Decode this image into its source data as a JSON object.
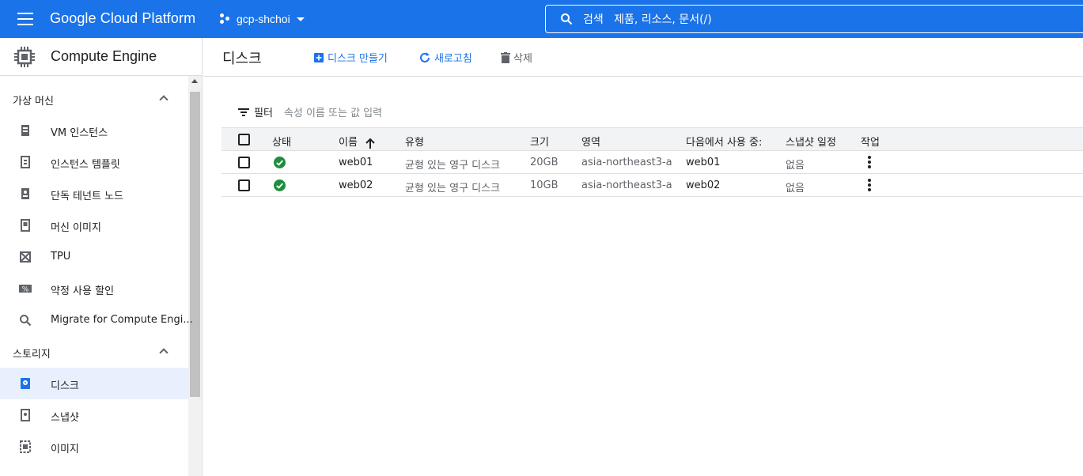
{
  "topbar": {
    "brand": "Google Cloud Platform",
    "project": "gcp-shchoi",
    "search_placeholder": "검색   제품, 리소스, 문서(/)"
  },
  "sidebar": {
    "product": "Compute Engine",
    "sections": [
      {
        "label": "가상 머신",
        "items": [
          {
            "label": "VM 인스턴스",
            "icon": "vm-icon"
          },
          {
            "label": "인스턴스 템플릿",
            "icon": "template-icon"
          },
          {
            "label": "단독 테넌트 노드",
            "icon": "node-icon"
          },
          {
            "label": "머신 이미지",
            "icon": "machine-image-icon"
          },
          {
            "label": "TPU",
            "icon": "tpu-icon"
          },
          {
            "label": "약정 사용 할인",
            "icon": "percent-icon"
          },
          {
            "label": "Migrate for Compute Engi...",
            "icon": "search-icon"
          }
        ]
      },
      {
        "label": "스토리지",
        "items": [
          {
            "label": "디스크",
            "icon": "disk-icon",
            "active": true
          },
          {
            "label": "스냅샷",
            "icon": "snapshot-icon"
          },
          {
            "label": "이미지",
            "icon": "image-icon"
          }
        ]
      }
    ]
  },
  "toolbar": {
    "title": "디스크",
    "create_label": "디스크 만들기",
    "refresh_label": "새로고침",
    "delete_label": "삭제"
  },
  "filter": {
    "label": "필터",
    "placeholder": "속성 이름 또는 값 입력"
  },
  "table": {
    "columns": [
      "상태",
      "이름",
      "유형",
      "크기",
      "영역",
      "다음에서 사용 중:",
      "스냅샷 일정",
      "작업"
    ],
    "rows": [
      {
        "status": "ok",
        "name": "web01",
        "type": "균형 있는 영구 디스크",
        "size": "20GB",
        "zone": "asia-northeast3-a",
        "in_use_by": "web01",
        "schedule": "없음"
      },
      {
        "status": "ok",
        "name": "web02",
        "type": "균형 있는 영구 디스크",
        "size": "10GB",
        "zone": "asia-northeast3-a",
        "in_use_by": "web02",
        "schedule": "없음"
      }
    ]
  },
  "colors": {
    "brand_blue": "#1a73e8",
    "status_green": "#1e8e3e",
    "active_bg": "#e8f0fe"
  }
}
